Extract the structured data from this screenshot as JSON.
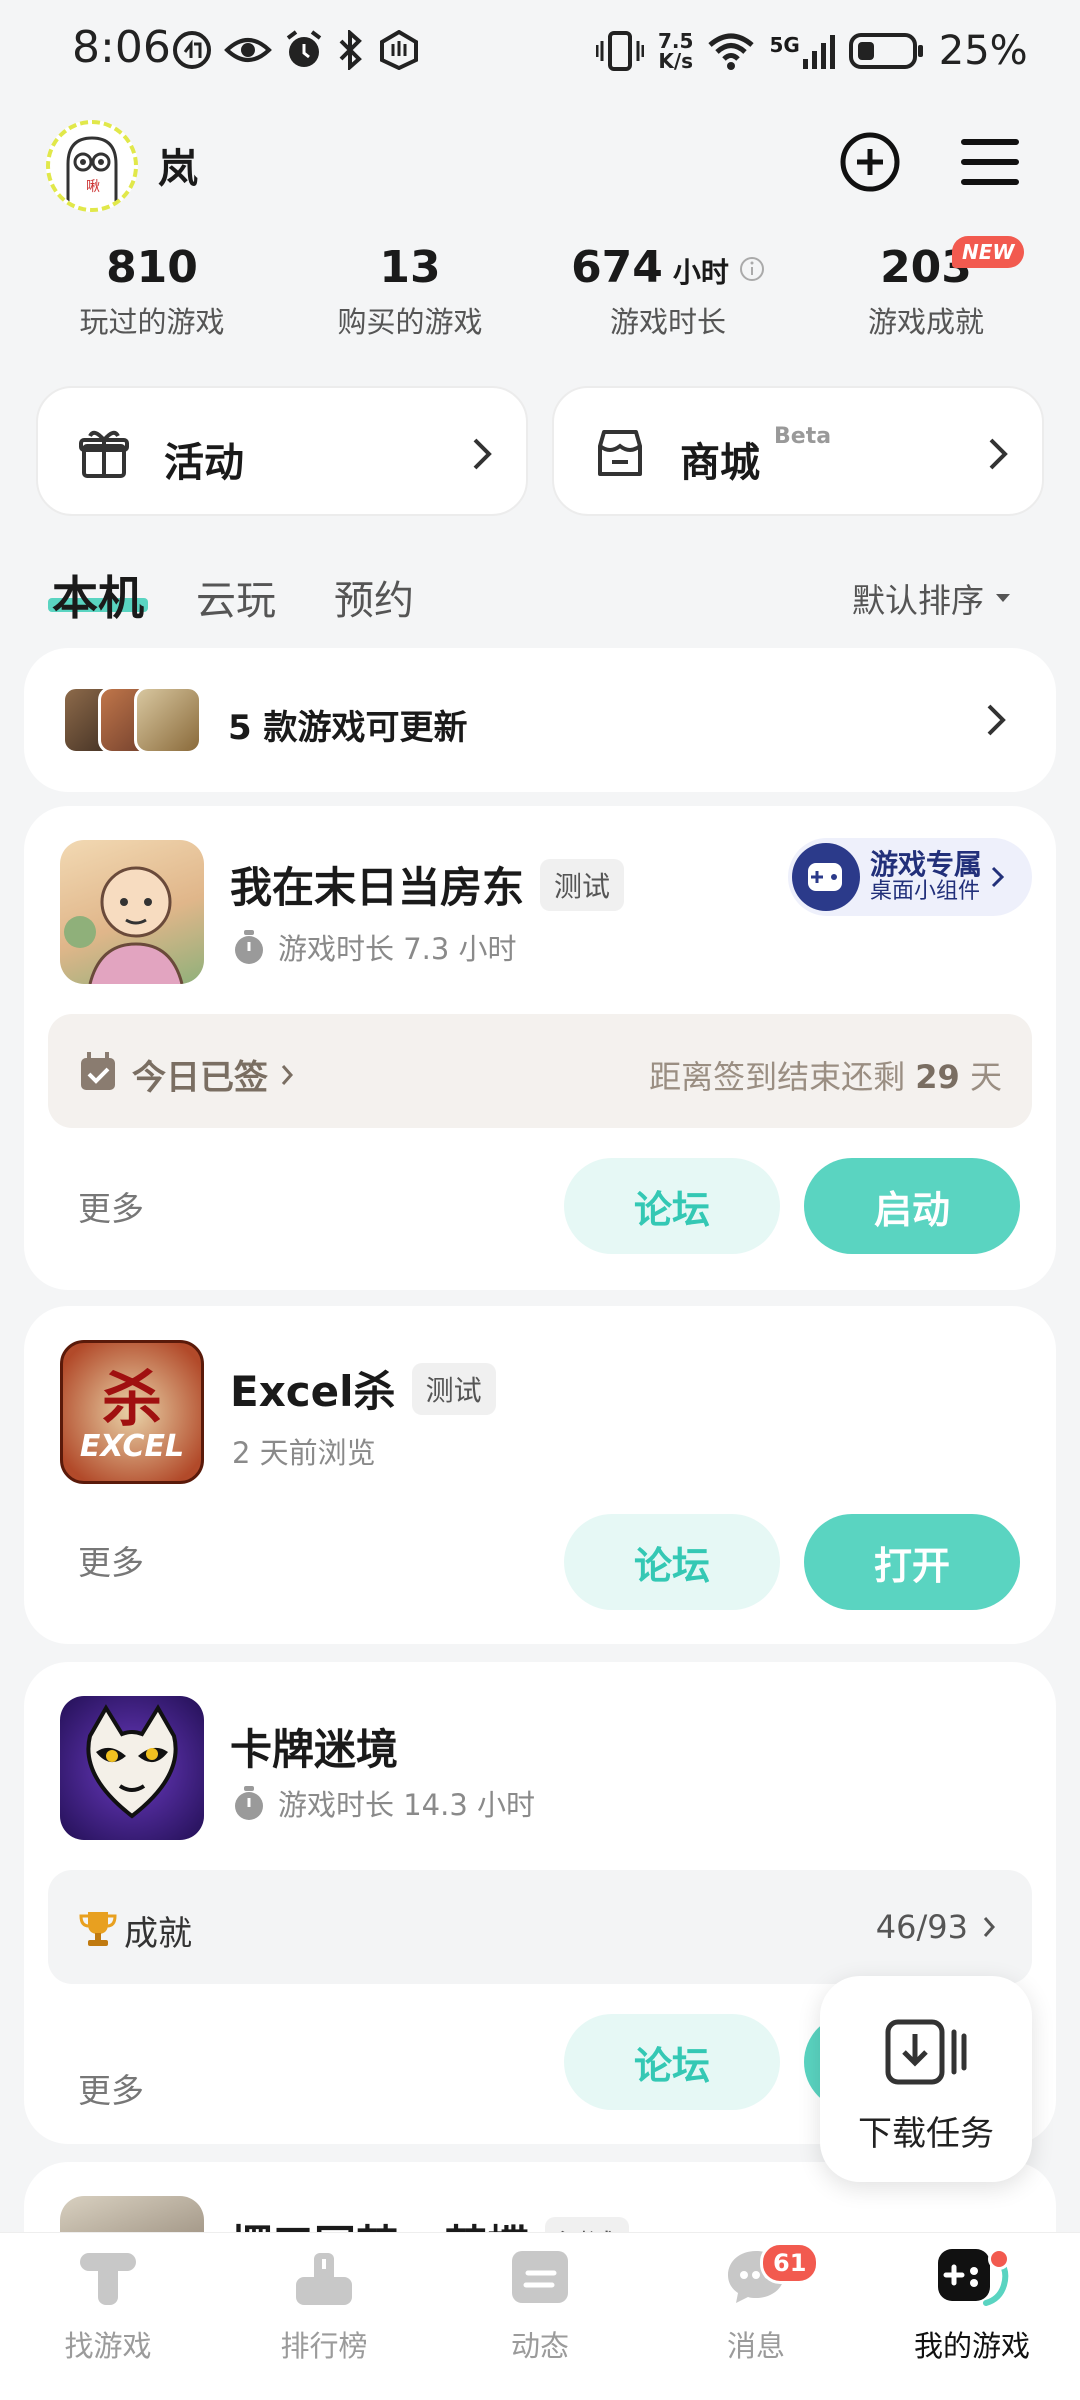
{
  "status_bar": {
    "time": "8:06",
    "speed_top": "7.5",
    "speed_bottom": "K/s",
    "network": "5G",
    "battery": "25%"
  },
  "profile": {
    "username": "岚",
    "avatar_text": "啾"
  },
  "stats": [
    {
      "value": "810",
      "label": "玩过的游戏"
    },
    {
      "value": "13",
      "label": "购买的游戏"
    },
    {
      "value": "674",
      "unit": "小时",
      "label": "游戏时长"
    },
    {
      "value": "203",
      "label": "游戏成就",
      "badge": "NEW"
    }
  ],
  "quick_links": {
    "activity": "活动",
    "mall": "商城",
    "mall_badge": "Beta"
  },
  "tabs": {
    "local": "本机",
    "cloud": "云玩",
    "reserve": "预约",
    "sort": "默认排序"
  },
  "update_banner": {
    "text": "5 款游戏可更新"
  },
  "games": [
    {
      "title": "我在末日当房东",
      "tag": "测试",
      "sub": "游戏时长 7.3 小时",
      "widget_title": "游戏专属",
      "widget_sub": "桌面小组件",
      "checkin": "今日已签",
      "checkin_remain_prefix": "距离签到结束还剩 ",
      "checkin_days": "29",
      "checkin_remain_suffix": " 天",
      "more": "更多",
      "forum": "论坛",
      "action": "启动"
    },
    {
      "title": "Excel杀",
      "tag": "测试",
      "sub": "2 天前浏览",
      "icon_top": "杀",
      "icon_bottom": "EXCEL",
      "more": "更多",
      "forum": "论坛",
      "action": "打开"
    },
    {
      "title": "卡牌迷境",
      "sub": "游戏时长 14.3 小时",
      "achievement": "成就",
      "achievement_progress": "46/93",
      "more": "更多",
      "forum": "论坛"
    },
    {
      "title": "摆三国梦 - 梦蝶",
      "tag": "测试"
    }
  ],
  "download_task": "下载任务",
  "bottom_nav": [
    {
      "label": "找游戏"
    },
    {
      "label": "排行榜"
    },
    {
      "label": "动态"
    },
    {
      "label": "消息",
      "badge": "61"
    },
    {
      "label": "我的游戏"
    }
  ],
  "colors": {
    "accent": "#5ad4c1",
    "accent_light": "#e6f8f5",
    "badge_red": "#f25a4f"
  }
}
